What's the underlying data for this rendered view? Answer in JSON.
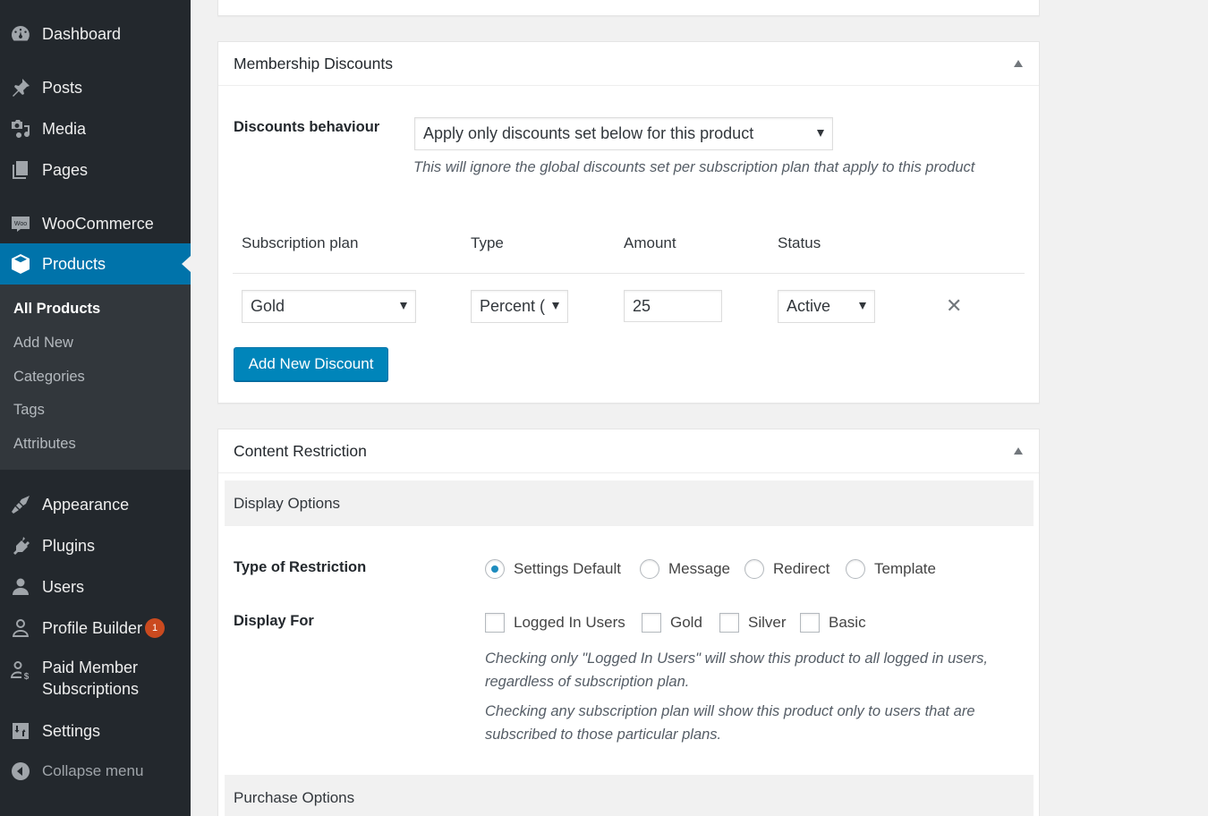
{
  "sidebar": {
    "items": [
      {
        "label": "Dashboard",
        "icon": "dashboard-icon"
      },
      {
        "label": "Posts",
        "icon": "pin-icon"
      },
      {
        "label": "Media",
        "icon": "media-icon"
      },
      {
        "label": "Pages",
        "icon": "pages-icon"
      },
      {
        "label": "WooCommerce",
        "icon": "woo-icon"
      },
      {
        "label": "Products",
        "icon": "box-icon",
        "active": true
      },
      {
        "label": "Appearance",
        "icon": "brush-icon"
      },
      {
        "label": "Plugins",
        "icon": "plug-icon"
      },
      {
        "label": "Users",
        "icon": "user-icon"
      },
      {
        "label": "Profile Builder",
        "icon": "profile-icon",
        "badge": "1"
      },
      {
        "label": "Paid Member Subscriptions",
        "line1": "Paid Member",
        "line2": "Subscriptions",
        "icon": "member-dollar-icon"
      },
      {
        "label": "Settings",
        "icon": "sliders-icon"
      }
    ],
    "submenu": [
      "All Products",
      "Add New",
      "Categories",
      "Tags",
      "Attributes"
    ],
    "collapse_label": "Collapse menu"
  },
  "membership": {
    "title": "Membership Discounts",
    "behaviour_label": "Discounts behaviour",
    "behaviour_value": "Apply only discounts set below for this product",
    "behaviour_desc": "This will ignore the global discounts set per subscription plan that apply to this product",
    "columns": [
      "Subscription plan",
      "Type",
      "Amount",
      "Status"
    ],
    "rows": [
      {
        "plan": "Gold",
        "type": "Percent (",
        "amount": "25",
        "status": "Active"
      }
    ],
    "add_button": "Add New Discount"
  },
  "restriction": {
    "title": "Content Restriction",
    "display_options": "Display Options",
    "type_label": "Type of Restriction",
    "type_options": [
      {
        "label": "Settings Default",
        "checked": true
      },
      {
        "label": "Message",
        "checked": false
      },
      {
        "label": "Redirect",
        "checked": false
      },
      {
        "label": "Template",
        "checked": false
      }
    ],
    "display_for_label": "Display For",
    "display_for_options": [
      {
        "label": "Logged In Users",
        "checked": false
      },
      {
        "label": "Gold",
        "checked": false
      },
      {
        "label": "Silver",
        "checked": false
      },
      {
        "label": "Basic",
        "checked": false
      }
    ],
    "desc1_line1": "Checking only \"Logged In Users\" will show this product to all logged in users,",
    "desc1_line2": "regardless of subscription plan.",
    "desc2_line1": "Checking any subscription plan will show this product only to users that are",
    "desc2_line2": "subscribed to those particular plans.",
    "purchase_options": "Purchase Options"
  }
}
